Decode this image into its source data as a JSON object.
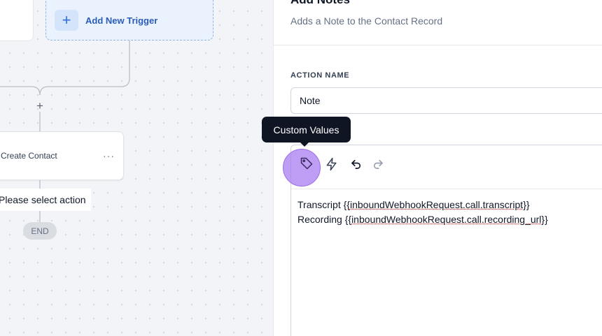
{
  "canvas": {
    "add_trigger": {
      "icon": "plus-icon",
      "label": "Add New Trigger"
    },
    "add_step_icon": "plus-icon",
    "action_node": {
      "label": "Create Contact",
      "menu_icon": "more-horizontal-icon"
    },
    "select_action_text": "Please select action",
    "end_label": "END"
  },
  "panel": {
    "title": "Add Notes",
    "subtitle": "Adds a Note to the Contact Record",
    "action_name_label": "ACTION NAME",
    "action_name_value": "Note",
    "editor": {
      "toolbar": [
        "tag-icon",
        "lightning-icon",
        "undo-icon",
        "redo-icon"
      ],
      "lines": [
        {
          "prefix": "Transcript ",
          "open": "{{",
          "variable": "inboundWebhookRequest.call.transcript",
          "close": "}}"
        },
        {
          "prefix": "Recording ",
          "open": "{{",
          "variable": "inboundWebhookRequest.call.recording_url",
          "close": "}}"
        }
      ]
    }
  },
  "tooltip": {
    "text": "Custom Values"
  },
  "colors": {
    "accent_blue": "#2b5cb8",
    "highlight_purple": "#a378f0",
    "tooltip_bg": "#0f1522"
  }
}
